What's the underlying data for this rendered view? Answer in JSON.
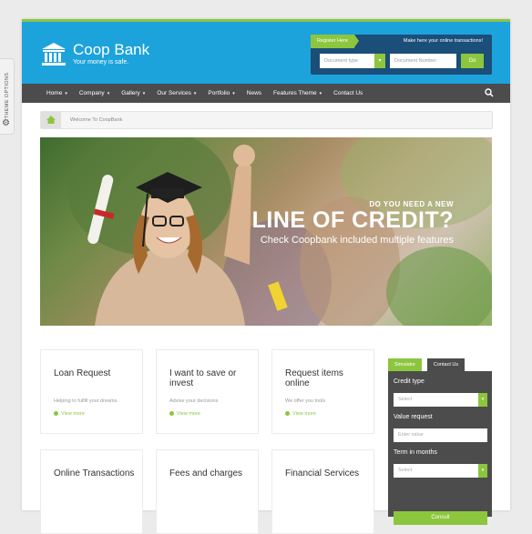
{
  "theme_options": {
    "label": "THEME OPTIONS"
  },
  "brand": {
    "name": "Coop Bank",
    "tagline": "Your money is safe."
  },
  "transactions": {
    "register_label": "Register Here",
    "note": "Make here your online transactions!",
    "doc_type_placeholder": "Document type",
    "doc_number_placeholder": "Document Number",
    "go_label": "Go"
  },
  "nav": {
    "items": [
      {
        "label": "Home",
        "caret": "▾"
      },
      {
        "label": "Company",
        "caret": "▾"
      },
      {
        "label": "Gallery",
        "caret": "▾"
      },
      {
        "label": "Our Services",
        "caret": "▾"
      },
      {
        "label": "Portfolio",
        "caret": "▾"
      },
      {
        "label": "News",
        "caret": ""
      },
      {
        "label": "Features Theme",
        "caret": "▾"
      },
      {
        "label": "Contact Us",
        "caret": ""
      }
    ]
  },
  "breadcrumb": {
    "text": "Welcome To CoopBank"
  },
  "hero": {
    "kicker": "DO YOU NEED A NEW",
    "headline": "LINE OF CREDIT?",
    "subline": "Check Coopbank included multiple features"
  },
  "cards": [
    {
      "title": "Loan Request",
      "subtitle": "Helping to fulfill your dreams.",
      "link": "View more"
    },
    {
      "title": "I want to save or invest",
      "subtitle": "Advise your decisions",
      "link": "View more"
    },
    {
      "title": "Request items online",
      "subtitle": "We offer you tools",
      "link": "View more"
    },
    {
      "title": "Online Transactions",
      "subtitle": "",
      "link": ""
    },
    {
      "title": "Fees and charges",
      "subtitle": "",
      "link": ""
    },
    {
      "title": "Financial Services",
      "subtitle": "",
      "link": ""
    }
  ],
  "simulator": {
    "tab_simulator": "Simulator",
    "tab_contact": "Contact Us",
    "credit_type_label": "Credit type",
    "credit_type_value": "Select",
    "value_label": "Value request",
    "value_placeholder": "Enter value",
    "term_label": "Term in months",
    "term_value": "Select",
    "consult_label": "Consult"
  },
  "colors": {
    "accent": "#8cc63e",
    "header": "#1da3dc",
    "nav": "#4c4c4c"
  }
}
